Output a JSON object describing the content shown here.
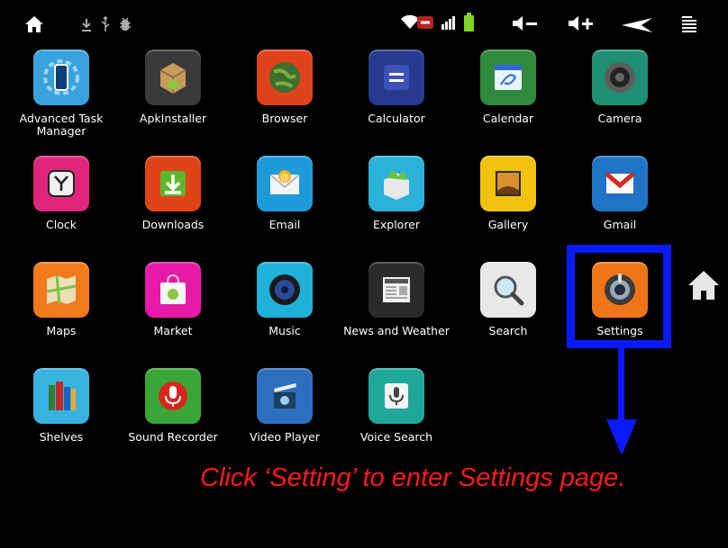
{
  "status_bar": {
    "left_icons": [
      "home-icon",
      "download-icon",
      "usb-icon",
      "debug-icon"
    ],
    "right_icons": [
      "wifi-icon",
      "signal-icon",
      "battery-icon",
      "volume-down-icon",
      "volume-up-icon",
      "back-icon",
      "menu-icon"
    ],
    "colors": {
      "battery": "#7dd321",
      "wifi": "#ffffff"
    }
  },
  "apps": [
    {
      "label": "Advanced Task Manager",
      "icon": "task-manager-icon",
      "color": "#3aa7e0"
    },
    {
      "label": "ApkInstaller",
      "icon": "apk-installer-icon",
      "color": "#3a3a3a"
    },
    {
      "label": "Browser",
      "icon": "browser-globe-icon",
      "color": "#e0421c"
    },
    {
      "label": "Calculator",
      "icon": "calculator-icon",
      "color": "#283a8f"
    },
    {
      "label": "Calendar",
      "icon": "calendar-icon",
      "color": "#2f8a3d"
    },
    {
      "label": "Camera",
      "icon": "camera-icon",
      "color": "#1f8f76"
    },
    {
      "label": "Clock",
      "icon": "clock-icon",
      "color": "#e0267a"
    },
    {
      "label": "Downloads",
      "icon": "downloads-icon",
      "color": "#e04317"
    },
    {
      "label": "Email",
      "icon": "email-icon",
      "color": "#1f9ad8"
    },
    {
      "label": "Explorer",
      "icon": "explorer-icon",
      "color": "#2ab2d8"
    },
    {
      "label": "Gallery",
      "icon": "gallery-icon",
      "color": "#f2c20f"
    },
    {
      "label": "Gmail",
      "icon": "gmail-icon",
      "color": "#1f74c6"
    },
    {
      "label": "Maps",
      "icon": "maps-icon",
      "color": "#f27a1c"
    },
    {
      "label": "Market",
      "icon": "market-icon",
      "color": "#e61aa6"
    },
    {
      "label": "Music",
      "icon": "music-icon",
      "color": "#1fb2d8"
    },
    {
      "label": "News and Weather",
      "icon": "news-icon",
      "color": "#2b2b2b"
    },
    {
      "label": "Search",
      "icon": "search-icon",
      "color": "#e8e8e8"
    },
    {
      "label": "Settings",
      "icon": "settings-icon",
      "color": "#f07418"
    },
    {
      "label": "Shelves",
      "icon": "shelves-icon",
      "color": "#38b3e0"
    },
    {
      "label": "Sound Recorder",
      "icon": "sound-recorder-icon",
      "color": "#3aa63a"
    },
    {
      "label": "Video Player",
      "icon": "video-player-icon",
      "color": "#2c6fbf"
    },
    {
      "label": "Voice Search",
      "icon": "voice-search-icon",
      "color": "#1fa89a"
    }
  ],
  "side": {
    "icon": "home-icon"
  },
  "annotation": {
    "caption": "Click ‘Setting’ to enter Settings page.",
    "highlight_color": "#0a19ff",
    "caption_color": "#ff1a1a"
  }
}
